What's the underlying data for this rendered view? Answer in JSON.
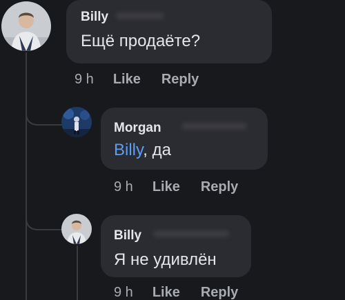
{
  "comments": [
    {
      "author": "Billy",
      "text": "Ещё продаёте?",
      "time": "9 h",
      "like_label": "Like",
      "reply_label": "Reply"
    },
    {
      "author": "Morgan",
      "mention": "Billy",
      "text_after_mention": ", да",
      "time": "9 h",
      "like_label": "Like",
      "reply_label": "Reply"
    },
    {
      "author": "Billy",
      "text": "Я не удивлён",
      "time": "9 h",
      "like_label": "Like",
      "reply_label": "Reply"
    }
  ],
  "colors": {
    "background": "#18191d",
    "bubble": "#2b2c31",
    "mention": "#5c9ef5",
    "meta_text": "#a8abb0"
  }
}
